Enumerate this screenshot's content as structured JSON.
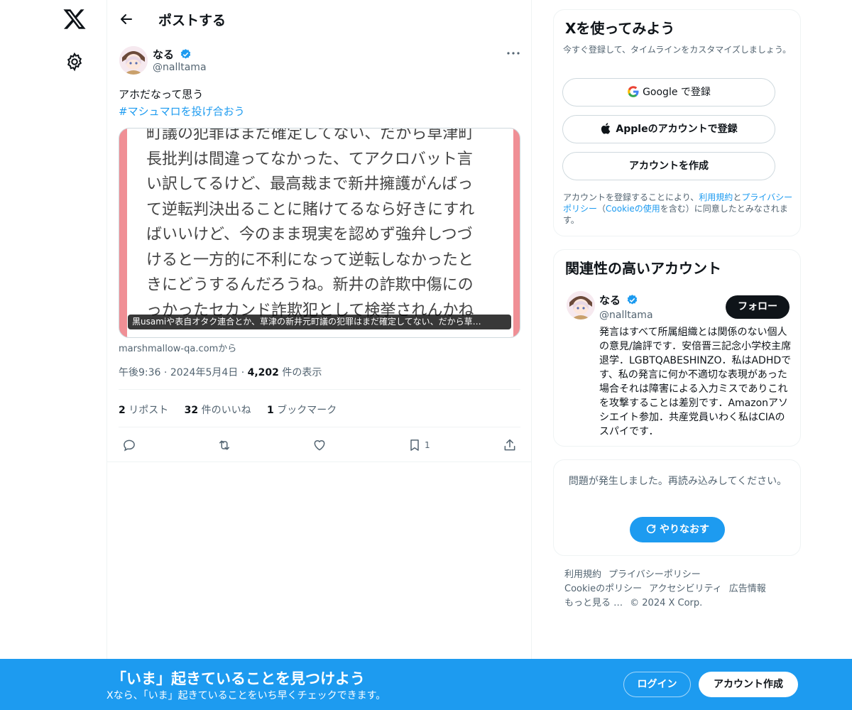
{
  "nav": {
    "logo_icon": "x-logo-icon",
    "settings_icon": "gear-icon"
  },
  "header": {
    "title": "ポストする"
  },
  "post": {
    "author_name": "なる",
    "author_handle": "@nalltama",
    "text": "アホだなって思う",
    "hashtag": "#マシュマロを投げ合おう",
    "media_lines": [
      "町議の犯罪はまだ確定してない、だから草津町",
      "長批判は間違ってなかった、てアクロバット言",
      "い訳してるけど、最高裁まで新井擁護がんばっ",
      "て逆転判決出ることに賭けてるなら好きにすれ",
      "ばいいけど、今のまま現実を認めず強弁しつづ",
      "けると一方的に不利になって逆転しなかったと",
      "きにどうするんだろうね。新井の詐欺中傷にの",
      "っかったセカンド詐欺犯として検挙されんかね"
    ],
    "media_caption": "黒usamiや表自オタク連合とか、草津の新井元町議の犯罪はまだ確定してない、だから草…",
    "source": "marshmallow-qa.comから",
    "time": "午後9:36",
    "date": "2024年5月4日",
    "views_count": "4,202",
    "views_label": "件の表示",
    "reposts_count": "2",
    "reposts_label": "リポスト",
    "likes_count": "32",
    "likes_label": "件のいいね",
    "bookmarks_count": "1",
    "bookmarks_label": "ブックマーク",
    "bookmark_action_count": "1"
  },
  "signup": {
    "title": "Xを使ってみよう",
    "desc": "今すぐ登録して、タイムラインをカスタマイズしましょう。",
    "google_label": "Google で登録",
    "apple_label": "Appleのアカウントで登録",
    "create_label": "アカウントを作成",
    "legal_prefix": "アカウントを登録することにより、",
    "terms_link": "利用規約",
    "and": "と",
    "privacy_link": "プライバシーポリシー",
    "open_paren": "（",
    "cookie_link": "Cookieの使用",
    "legal_suffix": "を含む）に同意したとみなされます。"
  },
  "related": {
    "title": "関連性の高いアカウント",
    "name": "なる",
    "handle": "@nalltama",
    "follow_label": "フォロー",
    "bio": "発言はすべて所属組織とは関係のない個人の意見/論評です．安倍晋三記念小学校主席退学．LGBTQABESHINZO．私はADHDです、私の発言に何か不適切な表現があった場合それは障害による入力ミスでありこれを攻撃することは差別です．Amazonアソシエイト参加．共産党員いわく私はCIAのスパイです．"
  },
  "error": {
    "text": "問題が発生しました。再読み込みしてください。",
    "retry_label": "やりなおす"
  },
  "footer": {
    "terms": "利用規約",
    "privacy": "プライバシーポリシー",
    "cookie": "Cookieのポリシー",
    "accessibility": "アクセシビリティ",
    "ads": "広告情報",
    "more": "もっと見る …",
    "copyright": "© 2024 X Corp."
  },
  "banner": {
    "title": "「いま」起きていることを見つけよう",
    "subtitle": "Xなら、「いま」起きていることをいち早くチェックできます。",
    "login_label": "ログイン",
    "create_label": "アカウント作成"
  },
  "colors": {
    "accent": "#1d9bf0",
    "text": "#0f1419",
    "muted": "#536471",
    "media_border": "#f08f95"
  }
}
